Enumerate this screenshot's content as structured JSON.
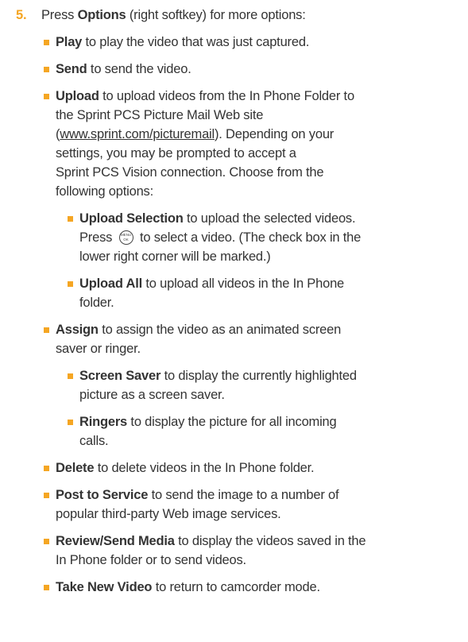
{
  "step": {
    "number": "5.",
    "intro_pre": "Press ",
    "intro_bold": "Options",
    "intro_post": " (right softkey) for more options:"
  },
  "items": {
    "play": {
      "bold": "Play",
      "text": " to play the video that was just captured."
    },
    "send": {
      "bold": "Send",
      "text": " to send the video."
    },
    "upload": {
      "bold": "Upload",
      "line1": " to upload videos from the In Phone Folder to",
      "line2": "the Sprint PCS Picture Mail Web site",
      "link_open": "(",
      "link": "www.sprint.com/picturemail",
      "line3_rest": "). Depending on your",
      "line4": "settings, you may be prompted to accept a",
      "line5": "Sprint PCS Vision connection. Choose from the",
      "line6": "following options:"
    },
    "upload_selection": {
      "bold": "Upload Selection",
      "line1": " to upload the selected videos.",
      "line2_pre": "Press ",
      "line2_post": " to select a video. (The check box in the",
      "line3": "lower right corner will be marked.)"
    },
    "upload_all": {
      "bold": "Upload All",
      "line1": " to upload all videos in the In Phone",
      "line2": "folder."
    },
    "assign": {
      "bold": "Assign",
      "line1": " to assign the video as an animated screen",
      "line2": "saver or ringer."
    },
    "screen_saver": {
      "bold": "Screen Saver",
      "line1": " to display the currently highlighted",
      "line2": "picture as a screen saver."
    },
    "ringers": {
      "bold": "Ringers",
      "line1": " to display the picture for all incoming",
      "line2": "calls."
    },
    "delete": {
      "bold": "Delete",
      "text": " to delete videos in the In Phone folder."
    },
    "post": {
      "bold": "Post to Service",
      "line1": " to send the image to a number of",
      "line2": "popular third-party Web image services."
    },
    "review": {
      "bold": "Review/Send Media",
      "line1": " to display the videos saved in the",
      "line2": "In Phone folder or to send videos."
    },
    "take": {
      "bold": "Take New Video",
      "text": " to return to camcorder mode."
    }
  },
  "menu_ok_icon": {
    "icon": "menu-ok-key-icon",
    "top": "MENU",
    "bottom": "OK"
  },
  "colors": {
    "accent": "#f5a623",
    "text": "#333333"
  }
}
